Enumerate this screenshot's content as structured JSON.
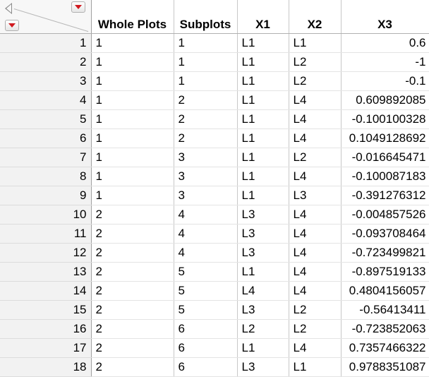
{
  "columns": [
    {
      "key": "whole_plots",
      "label": "Whole Plots",
      "align": "left"
    },
    {
      "key": "subplots",
      "label": "Subplots",
      "align": "left"
    },
    {
      "key": "x1",
      "label": "X1",
      "align": "left"
    },
    {
      "key": "x2",
      "label": "X2",
      "align": "left"
    },
    {
      "key": "x3",
      "label": "X3",
      "align": "right"
    }
  ],
  "rows": [
    {
      "n": "1",
      "whole_plots": "1",
      "subplots": "1",
      "x1": "L1",
      "x2": "L1",
      "x3": "0.6"
    },
    {
      "n": "2",
      "whole_plots": "1",
      "subplots": "1",
      "x1": "L1",
      "x2": "L2",
      "x3": "-1"
    },
    {
      "n": "3",
      "whole_plots": "1",
      "subplots": "1",
      "x1": "L1",
      "x2": "L2",
      "x3": "-0.1"
    },
    {
      "n": "4",
      "whole_plots": "1",
      "subplots": "2",
      "x1": "L1",
      "x2": "L4",
      "x3": "0.609892085"
    },
    {
      "n": "5",
      "whole_plots": "1",
      "subplots": "2",
      "x1": "L1",
      "x2": "L4",
      "x3": "-0.100100328"
    },
    {
      "n": "6",
      "whole_plots": "1",
      "subplots": "2",
      "x1": "L1",
      "x2": "L4",
      "x3": "0.1049128692"
    },
    {
      "n": "7",
      "whole_plots": "1",
      "subplots": "3",
      "x1": "L1",
      "x2": "L2",
      "x3": "-0.016645471"
    },
    {
      "n": "8",
      "whole_plots": "1",
      "subplots": "3",
      "x1": "L1",
      "x2": "L4",
      "x3": "-0.100087183"
    },
    {
      "n": "9",
      "whole_plots": "1",
      "subplots": "3",
      "x1": "L1",
      "x2": "L3",
      "x3": "-0.391276312"
    },
    {
      "n": "10",
      "whole_plots": "2",
      "subplots": "4",
      "x1": "L3",
      "x2": "L4",
      "x3": "-0.004857526"
    },
    {
      "n": "11",
      "whole_plots": "2",
      "subplots": "4",
      "x1": "L3",
      "x2": "L4",
      "x3": "-0.093708464"
    },
    {
      "n": "12",
      "whole_plots": "2",
      "subplots": "4",
      "x1": "L3",
      "x2": "L4",
      "x3": "-0.723499821"
    },
    {
      "n": "13",
      "whole_plots": "2",
      "subplots": "5",
      "x1": "L1",
      "x2": "L4",
      "x3": "-0.897519133"
    },
    {
      "n": "14",
      "whole_plots": "2",
      "subplots": "5",
      "x1": "L4",
      "x2": "L4",
      "x3": "0.4804156057"
    },
    {
      "n": "15",
      "whole_plots": "2",
      "subplots": "5",
      "x1": "L3",
      "x2": "L2",
      "x3": "-0.56413411"
    },
    {
      "n": "16",
      "whole_plots": "2",
      "subplots": "6",
      "x1": "L2",
      "x2": "L2",
      "x3": "-0.723852063"
    },
    {
      "n": "17",
      "whole_plots": "2",
      "subplots": "6",
      "x1": "L1",
      "x2": "L4",
      "x3": "0.7357466322"
    },
    {
      "n": "18",
      "whole_plots": "2",
      "subplots": "6",
      "x1": "L3",
      "x2": "L1",
      "x3": "0.9788351087"
    }
  ],
  "icons": {
    "collapse": "left-arrow-icon",
    "columns_menu": "red-triangle-menu-icon",
    "rows_menu": "red-triangle-menu-icon"
  },
  "colors": {
    "menu_triangle": "#d0191f",
    "row_header_bg": "#f2f2f2"
  }
}
